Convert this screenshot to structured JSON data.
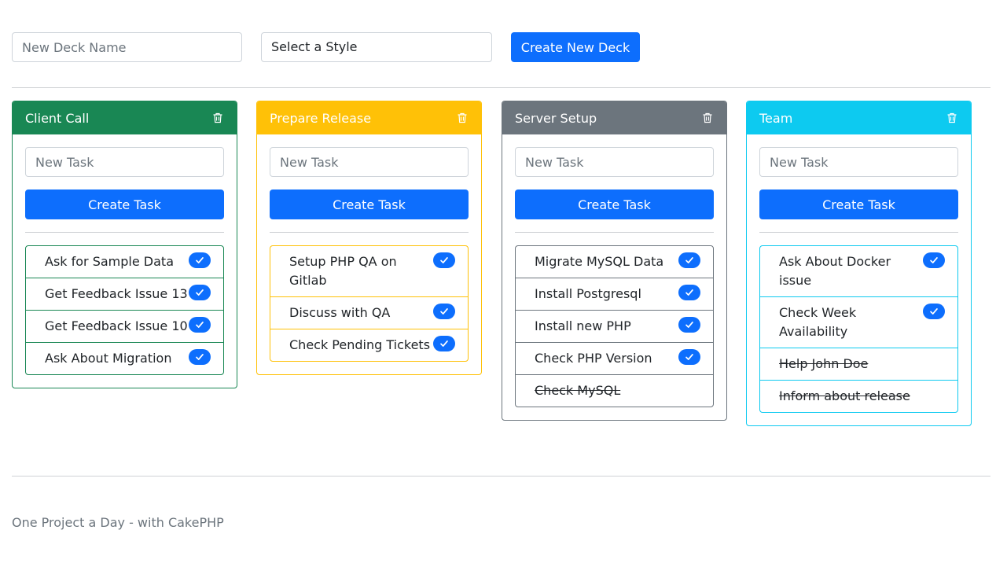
{
  "top": {
    "deck_name_placeholder": "New Deck Name",
    "style_select_value": "Select a Style",
    "create_deck_label": "Create New Deck"
  },
  "decks": [
    {
      "title": "Client Call",
      "color": "#198754",
      "header_text_color": "#ffffff",
      "task_placeholder": "New Task",
      "create_task_label": "Create Task",
      "tasks": [
        {
          "label": "Ask for Sample Data",
          "done": false
        },
        {
          "label": "Get Feedback Issue 13",
          "done": false
        },
        {
          "label": "Get Feedback Issue 10",
          "done": false
        },
        {
          "label": "Ask About Migration",
          "done": false
        }
      ]
    },
    {
      "title": "Prepare Release",
      "color": "#ffc107",
      "header_text_color": "#ffffff",
      "task_placeholder": "New Task",
      "create_task_label": "Create Task",
      "tasks": [
        {
          "label": "Setup PHP QA on Gitlab",
          "done": false
        },
        {
          "label": "Discuss with QA",
          "done": false
        },
        {
          "label": "Check Pending Tickets",
          "done": false
        }
      ]
    },
    {
      "title": "Server Setup",
      "color": "#6c757d",
      "header_text_color": "#ffffff",
      "task_placeholder": "New Task",
      "create_task_label": "Create Task",
      "tasks": [
        {
          "label": "Migrate MySQL Data",
          "done": false
        },
        {
          "label": "Install Postgresql",
          "done": false
        },
        {
          "label": "Install new PHP",
          "done": false
        },
        {
          "label": "Check PHP Version",
          "done": false
        },
        {
          "label": "Check MySQL",
          "done": true
        }
      ]
    },
    {
      "title": "Team",
      "color": "#0dcaf0",
      "header_text_color": "#ffffff",
      "task_placeholder": "New Task",
      "create_task_label": "Create Task",
      "tasks": [
        {
          "label": "Ask About Docker issue",
          "done": false
        },
        {
          "label": "Check Week Availability",
          "done": false
        },
        {
          "label": "Help John Doe",
          "done": true
        },
        {
          "label": "Inform about release",
          "done": true
        }
      ]
    }
  ],
  "footer": {
    "text": "One Project a Day - with CakePHP"
  },
  "icons": {
    "delete": "trash-icon",
    "complete": "check-icon"
  }
}
